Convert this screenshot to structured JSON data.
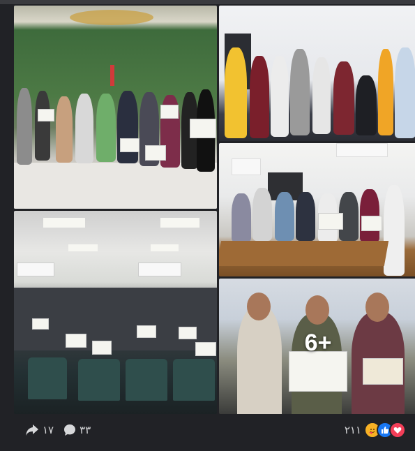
{
  "post": {
    "more_photos_label": "6+",
    "shares_count": "١٧",
    "comments_count": "٣٣",
    "reactions_count": "٢١١"
  },
  "icons": {
    "share": "share-arrow-icon",
    "comment": "comment-bubble-icon",
    "reactions": [
      "care-reaction-icon",
      "like-reaction-icon",
      "love-reaction-icon"
    ]
  },
  "colors": {
    "background": "#212226",
    "like": "#1877f2",
    "love": "#f33e58",
    "care": "#f7b125"
  }
}
